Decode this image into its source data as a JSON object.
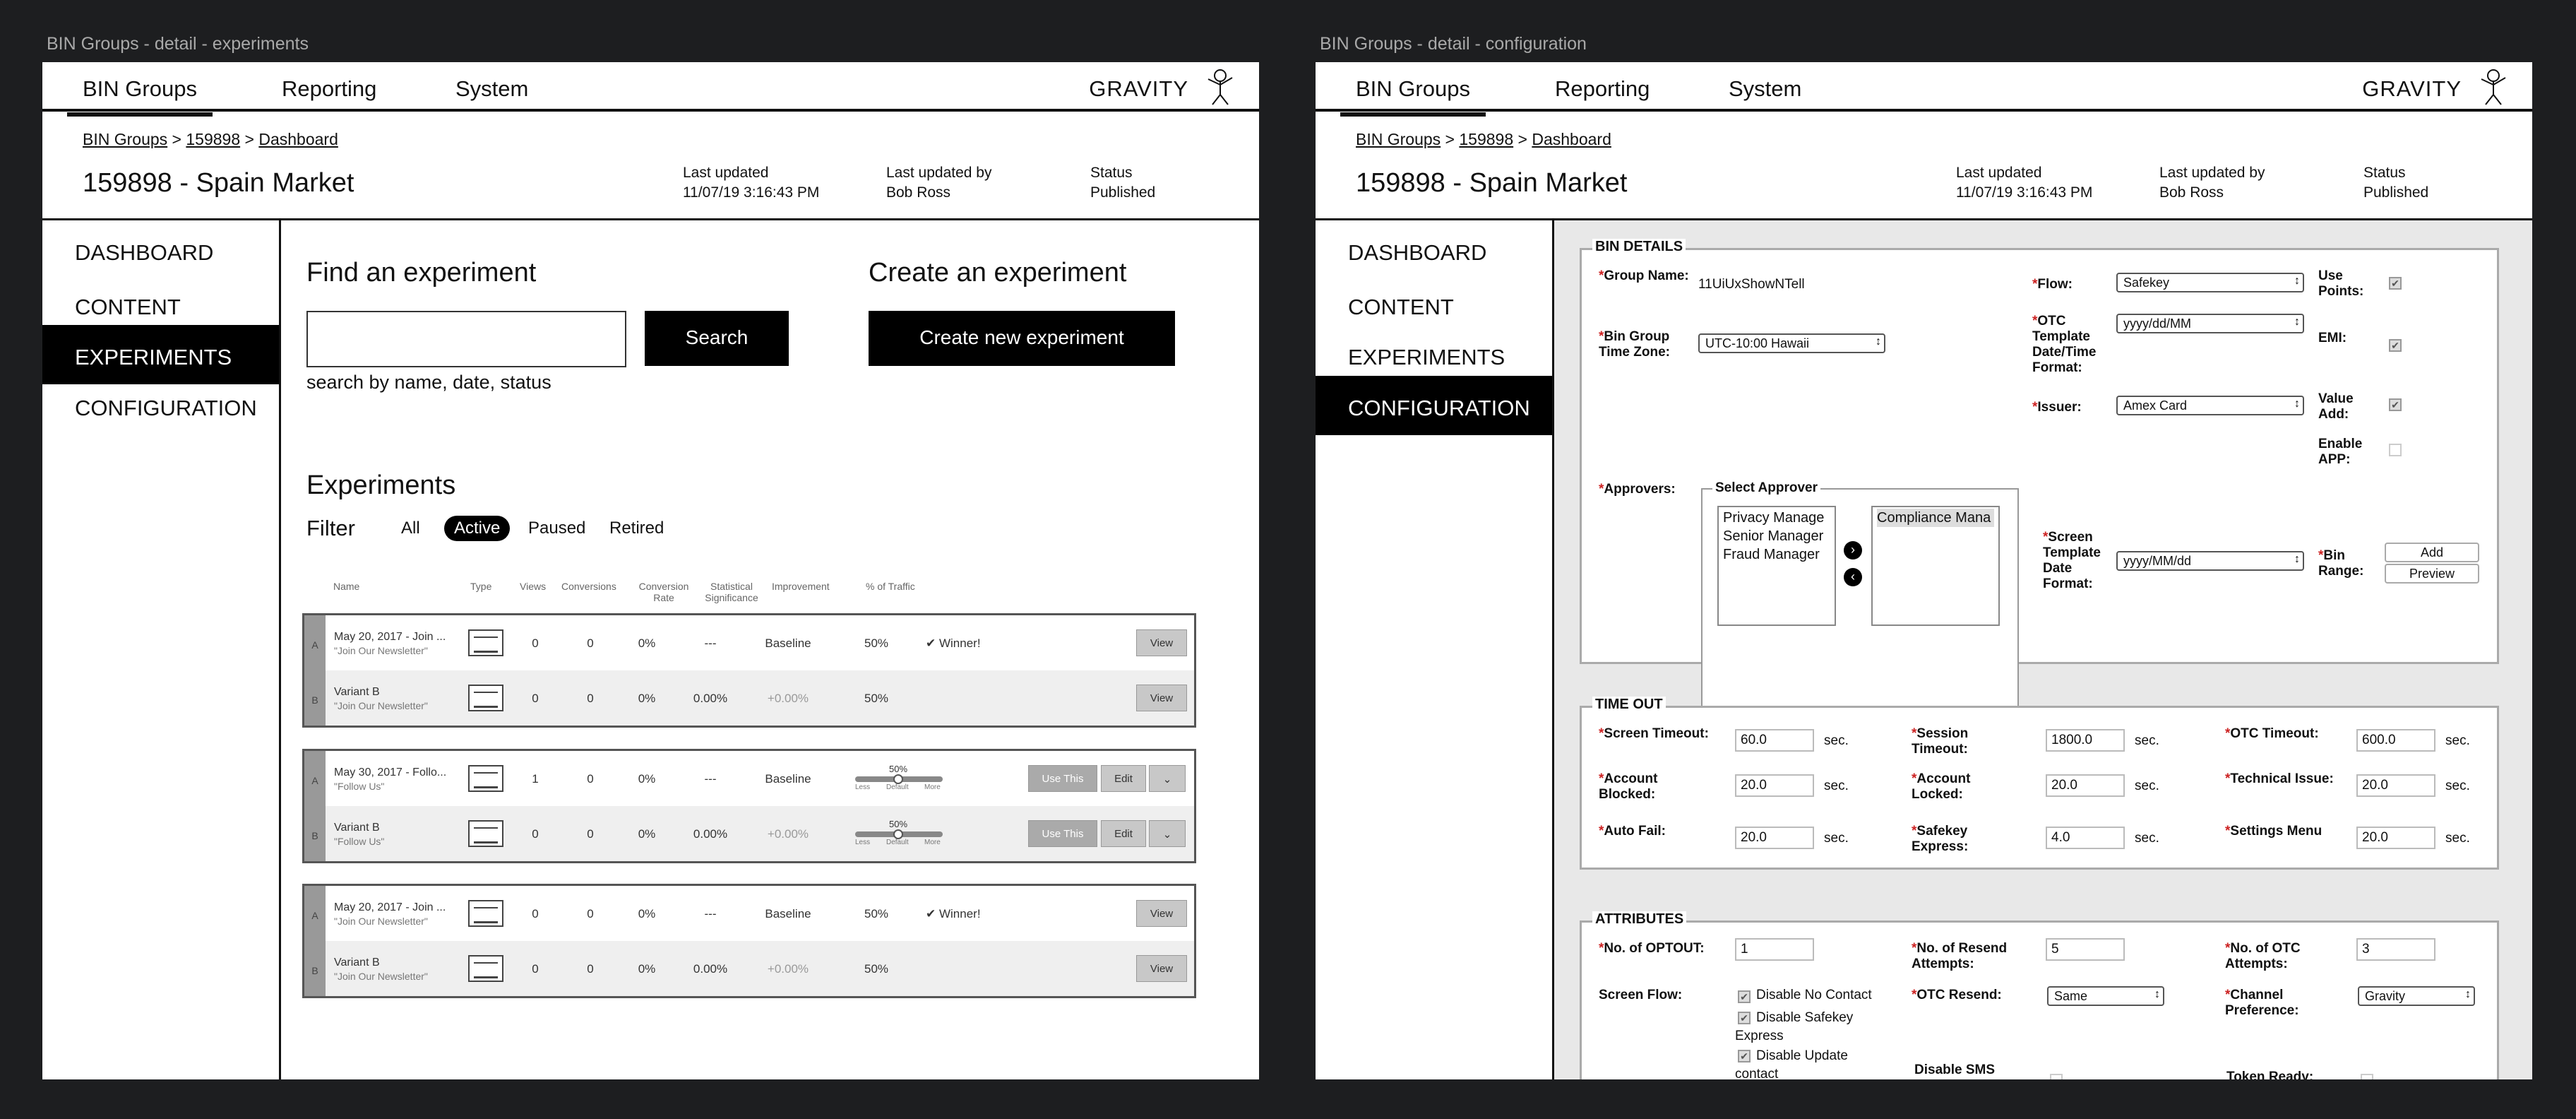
{
  "left": {
    "window_title": "BIN Groups - detail - experiments",
    "nav": {
      "tabs": [
        "BIN Groups",
        "Reporting",
        "System"
      ],
      "brand": "GRAVITY"
    },
    "breadcrumb": [
      "BIN Groups",
      "159898",
      "Dashboard"
    ],
    "page_title": "159898 - Spain Market",
    "meta": {
      "last_updated_label": "Last updated",
      "last_updated": "11/07/19 3:16:43 PM",
      "by_label": "Last updated by",
      "by": "Bob Ross",
      "status_label": "Status",
      "status": "Published"
    },
    "sidebar": [
      "DASHBOARD",
      "CONTENT",
      "EXPERIMENTS",
      "CONFIGURATION"
    ],
    "find": {
      "heading": "Find an experiment",
      "search_button": "Search",
      "hint": "search by name, date, status"
    },
    "create": {
      "heading": "Create an experiment",
      "button": "Create new experiment"
    },
    "experiments": {
      "heading": "Experiments",
      "filter_label": "Filter",
      "filters": [
        "All",
        "Active",
        "Paused",
        "Retired"
      ],
      "columns": [
        "Name",
        "Type",
        "Views",
        "Conversions",
        "Conversion Rate",
        "Statistical Significance",
        "Improvement",
        "% of Traffic"
      ],
      "groups": [
        {
          "rows": [
            {
              "letter": "A",
              "name": "May 20, 2017 - Join ...",
              "sub": "\"Join Our Newsletter\"",
              "views": "0",
              "conversions": "0",
              "rate": "0%",
              "sig": "---",
              "improvement": "Baseline",
              "traffic": "50%",
              "winner": "✔ Winner!",
              "actions": [
                "View"
              ]
            },
            {
              "letter": "B",
              "name": "Variant B",
              "sub": "\"Join Our Newsletter\"",
              "views": "0",
              "conversions": "0",
              "rate": "0%",
              "sig": "0.00%",
              "improvement": "+0.00%",
              "traffic": "50%",
              "winner": "",
              "actions": [
                "View"
              ]
            }
          ]
        },
        {
          "rows": [
            {
              "letter": "A",
              "name": "May 30, 2017 - Follo...",
              "sub": "\"Follow Us\"",
              "views": "1",
              "conversions": "0",
              "rate": "0%",
              "sig": "---",
              "improvement": "Baseline",
              "traffic": "50%",
              "winner": "",
              "actions": [
                "Use This",
                "Edit",
                "⌄"
              ]
            },
            {
              "letter": "B",
              "name": "Variant B",
              "sub": "\"Follow Us\"",
              "views": "0",
              "conversions": "0",
              "rate": "0%",
              "sig": "0.00%",
              "improvement": "+0.00%",
              "traffic": "50%",
              "winner": "",
              "actions": [
                "Use This",
                "Edit",
                "⌄"
              ]
            }
          ]
        },
        {
          "rows": [
            {
              "letter": "A",
              "name": "May 20, 2017 - Join ...",
              "sub": "\"Join Our Newsletter\"",
              "views": "0",
              "conversions": "0",
              "rate": "0%",
              "sig": "---",
              "improvement": "Baseline",
              "traffic": "50%",
              "winner": "✔ Winner!",
              "actions": [
                "View"
              ]
            },
            {
              "letter": "B",
              "name": "Variant B",
              "sub": "\"Join Our Newsletter\"",
              "views": "0",
              "conversions": "0",
              "rate": "0%",
              "sig": "0.00%",
              "improvement": "+0.00%",
              "traffic": "50%",
              "winner": "",
              "actions": [
                "View"
              ]
            }
          ]
        }
      ],
      "slider": {
        "value": "50%",
        "less": "Less",
        "default": "Default",
        "more": "More"
      }
    }
  },
  "right": {
    "window_title": "BIN Groups - detail - configuration",
    "nav": {
      "tabs": [
        "BIN Groups",
        "Reporting",
        "System"
      ],
      "brand": "GRAVITY"
    },
    "breadcrumb": [
      "BIN Groups",
      "159898",
      "Dashboard"
    ],
    "page_title": "159898 - Spain Market",
    "meta": {
      "last_updated_label": "Last updated",
      "last_updated": "11/07/19 3:16:43 PM",
      "by_label": "Last updated by",
      "by": "Bob Ross",
      "status_label": "Status",
      "status": "Published"
    },
    "sidebar": [
      "DASHBOARD",
      "CONTENT",
      "EXPERIMENTS",
      "CONFIGURATION"
    ],
    "bin_details": {
      "legend": "BIN DETAILS",
      "group_name_label": "Group Name:",
      "group_name": "11UiUxShowNTell",
      "timezone_label": "Bin Group Time Zone:",
      "timezone": "UTC-10:00 Hawaii",
      "flow_label": "Flow:",
      "flow": "Safekey",
      "otc_format_label": "OTC Template Date/Time Format:",
      "otc_format": "yyyy/dd/MM",
      "issuer_label": "Issuer:",
      "issuer": "Amex Card",
      "use_points_label": "Use Points:",
      "emi_label": "EMI:",
      "value_add_label": "Value Add:",
      "enable_app_label": "Enable APP:",
      "approvers_label": "Approvers:",
      "select_approver_legend": "Select Approver",
      "approvers_available": [
        "Privacy Manage",
        "Senior Manager",
        "Fraud Manager"
      ],
      "approvers_selected": [
        "Compliance Mana"
      ],
      "screen_format_label": "Screen Template Date Format:",
      "screen_format": "yyyy/MM/dd",
      "bin_range_label": "Bin Range:",
      "add_button": "Add",
      "preview_button": "Preview"
    },
    "time_out": {
      "legend": "TIME OUT",
      "fields": [
        {
          "label": "Screen Timeout:",
          "value": "60.0",
          "unit": "sec."
        },
        {
          "label": "Session Timeout:",
          "value": "1800.0",
          "unit": "sec."
        },
        {
          "label": "OTC Timeout:",
          "value": "600.0",
          "unit": "sec."
        },
        {
          "label": "Account Blocked:",
          "value": "20.0",
          "unit": "sec."
        },
        {
          "label": "Account Locked:",
          "value": "20.0",
          "unit": "sec."
        },
        {
          "label": "Technical Issue:",
          "value": "20.0",
          "unit": "sec."
        },
        {
          "label": "Auto Fail:",
          "value": "20.0",
          "unit": "sec."
        },
        {
          "label": "Safekey Express:",
          "value": "4.0",
          "unit": "sec."
        },
        {
          "label": "Settings Menu",
          "value": "20.0",
          "unit": "sec."
        }
      ]
    },
    "attributes": {
      "legend": "ATTRIBUTES",
      "optout_label": "No. of OPTOUT:",
      "optout": "1",
      "resend_label": "No. of Resend Attempts:",
      "resend": "5",
      "otc_attempts_label": "No. of OTC Attempts:",
      "otc_attempts": "3",
      "screen_flow_label": "Screen Flow:",
      "screen_flow_options": [
        "Disable No Contact",
        "Disable Safekey Express",
        "Disable Update contact"
      ],
      "otc_resend_label": "OTC Resend:",
      "otc_resend": "Same",
      "channel_label": "Channel Preference:",
      "channel": "Gravity",
      "disable_sms_label": "Disable SMS",
      "token_ready_label": "Token Ready:"
    }
  }
}
